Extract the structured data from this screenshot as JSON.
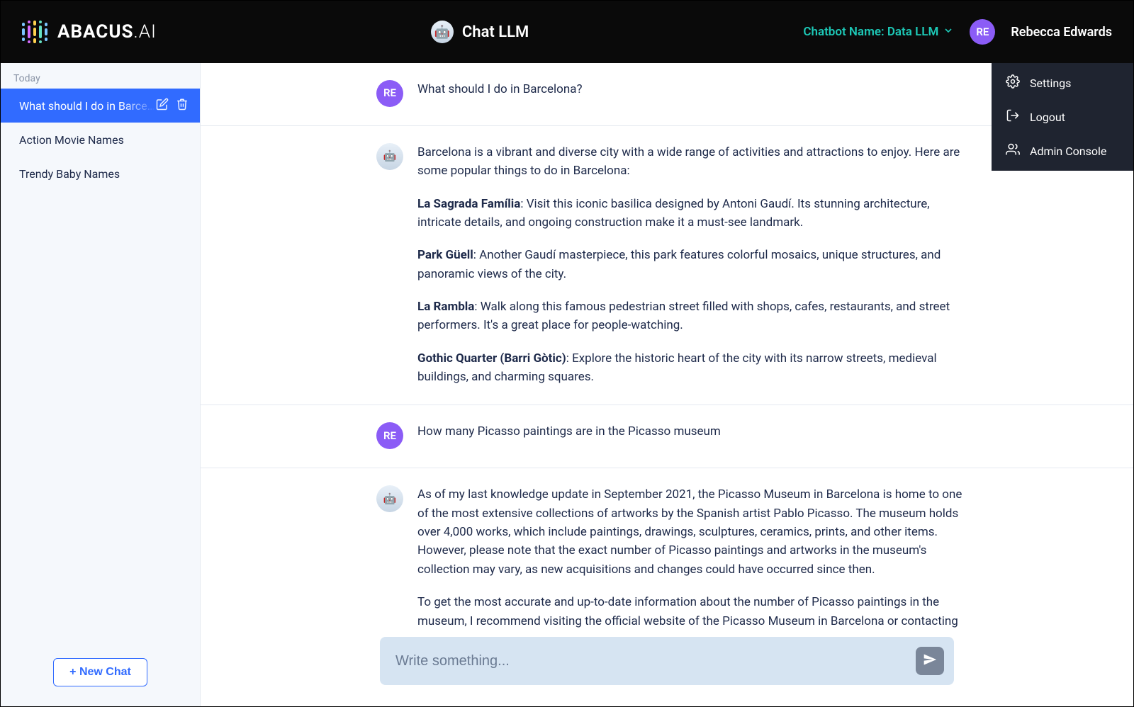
{
  "header": {
    "brand_name": "ABACUS",
    "brand_suffix": ".AI",
    "center_title": "Chat LLM",
    "chatbot_label": "Chatbot Name: Data LLM",
    "user_initials": "RE",
    "user_name": "Rebecca Edwards"
  },
  "user_menu": [
    {
      "label": "Settings",
      "icon": "settings-icon"
    },
    {
      "label": "Logout",
      "icon": "logout-icon"
    },
    {
      "label": "Admin Console",
      "icon": "admin-icon"
    }
  ],
  "sidebar": {
    "section_label": "Today",
    "items": [
      {
        "title": "What should I do in Barcelona?",
        "active": true
      },
      {
        "title": "Action Movie Names",
        "active": false
      },
      {
        "title": "Trendy Baby Names",
        "active": false
      }
    ],
    "new_chat_label": "+ New Chat"
  },
  "conversation": {
    "user_initials": "RE",
    "messages": [
      {
        "role": "user",
        "text": "What should I do in Barcelona?"
      },
      {
        "role": "assistant",
        "intro": "Barcelona is a vibrant and diverse city with a wide range of activities and attractions to enjoy. Here are some popular things to do in Barcelona:",
        "bullets": [
          {
            "title": "La Sagrada Família",
            "body": ": Visit this iconic basilica designed by Antoni Gaudí. Its stunning architecture, intricate details, and ongoing construction make it a must-see landmark."
          },
          {
            "title": "Park Güell",
            "body": ": Another Gaudí masterpiece, this park features colorful mosaics, unique structures, and panoramic views of the city."
          },
          {
            "title": "La Rambla",
            "body": ": Walk along this famous pedestrian street filled with shops, cafes, restaurants, and street performers. It's a great place for people-watching."
          },
          {
            "title": "Gothic Quarter (Barri Gòtic)",
            "body": ": Explore the historic heart of the city with its narrow streets, medieval buildings, and charming squares."
          }
        ]
      },
      {
        "role": "user",
        "text": "How many Picasso paintings are in the Picasso museum"
      },
      {
        "role": "assistant",
        "intro": "As of my last knowledge update in September 2021, the Picasso Museum in Barcelona is home to one of the most extensive collections of artworks by the Spanish artist Pablo Picasso. The museum holds over 4,000 works, which include paintings, drawings, sculptures, ceramics, prints, and other items. However, please note that the exact number of Picasso paintings and artworks in the museum's collection may vary, as new acquisitions and changes could have occurred since then.",
        "outro": "To get the most accurate and up-to-date information about the number of Picasso paintings in the museum, I recommend visiting the official website of the Picasso Museum in Barcelona or contacting the museum directly."
      }
    ]
  },
  "input": {
    "placeholder": "Write something..."
  }
}
